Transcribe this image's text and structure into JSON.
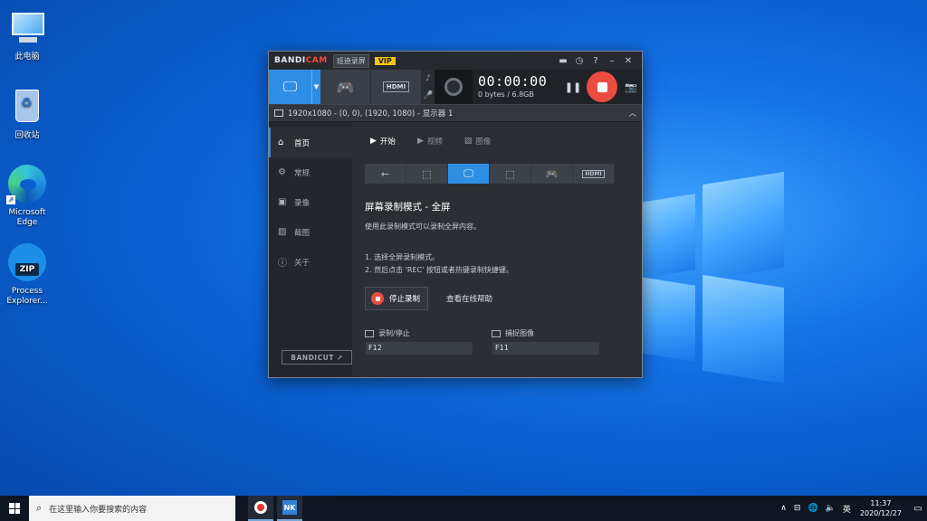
{
  "desktop": {
    "icons": [
      {
        "label": "此电脑",
        "icon": "computer-icon"
      },
      {
        "label": "回收站",
        "icon": "recycle-bin-icon"
      },
      {
        "label": "Microsoft Edge",
        "icon": "edge-icon"
      },
      {
        "label": "Process Explorer...",
        "icon": "zip-icon",
        "badge": "ZIP"
      }
    ]
  },
  "bandicam": {
    "title": {
      "brand_a": "BANDI",
      "brand_b": "CAM",
      "tag": "班迪录屏",
      "vip": "VIP"
    },
    "title_icons": [
      "folder-icon",
      "clock-icon",
      "help-icon",
      "minimize-icon",
      "close-icon"
    ],
    "toolbar": {
      "time": "00:00:00",
      "size": "0 bytes / 6.8GB",
      "hdmi": "HDMI"
    },
    "info_bar": "1920x1080 - (0, 0), (1920, 1080) - 显示器 1",
    "sidebar": [
      {
        "label": "首页",
        "icon": "home-icon",
        "glyph": "⌂"
      },
      {
        "label": "常规",
        "icon": "gear-icon",
        "glyph": "⚙"
      },
      {
        "label": "录像",
        "icon": "video-icon",
        "glyph": "▣"
      },
      {
        "label": "截图",
        "icon": "image-icon",
        "glyph": "▨"
      },
      {
        "label": "关于",
        "icon": "info-icon",
        "glyph": "ⓘ"
      }
    ],
    "bandicut": "BANDICUT ↗",
    "tabs": [
      {
        "label": "开始",
        "glyph": "▶"
      },
      {
        "label": "视频",
        "glyph": "▶"
      },
      {
        "label": "图像",
        "glyph": "▨"
      }
    ],
    "mode_title": "屏幕录制模式 - 全屏",
    "mode_desc": "使用此录制模式可以录制全屏内容。",
    "steps": [
      "1. 选择全屏录制模式。",
      "2. 然后点击 'REC' 按钮或者热键录制快捷键。"
    ],
    "stop_label": "停止录制",
    "help_label": "查看在线帮助",
    "hotkeys": [
      {
        "label": "录制/停止",
        "value": "F12"
      },
      {
        "label": "捕捉图像",
        "value": "F11"
      }
    ]
  },
  "taskbar": {
    "search_placeholder": "在这里输入你要搜索的内容",
    "nk_label": "NK",
    "tray": {
      "chevron": "∧",
      "lang": "英",
      "time": "11:37",
      "date": "2020/12/27"
    }
  },
  "colors": {
    "accent": "#2e8ee3",
    "record": "#ec4c3f"
  }
}
